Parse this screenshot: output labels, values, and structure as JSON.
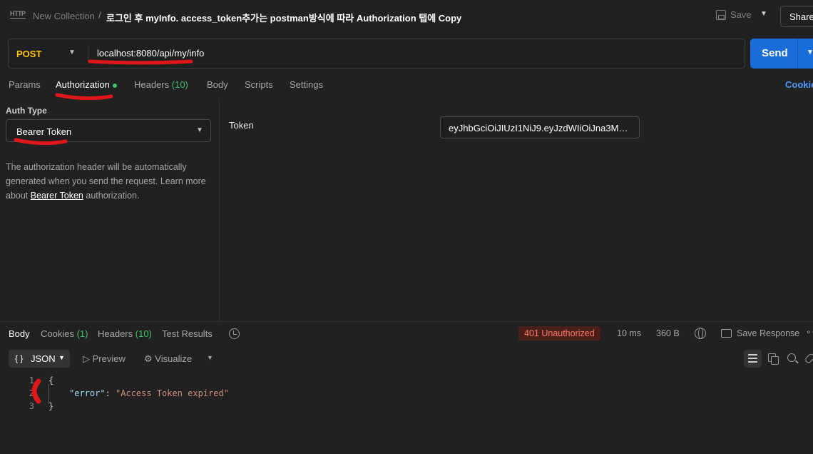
{
  "header": {
    "http_badge": "HTTP",
    "collection": "New Collection",
    "separator": "/",
    "request_name": "로그인 후 myInfo. access_token추가는 postman방식에 따라 Authorization 탭에 Copy",
    "save_label": "Save",
    "share_label": "Share"
  },
  "request": {
    "method": "POST",
    "url": "localhost:8080/api/my/info",
    "send_label": "Send"
  },
  "request_tabs": [
    {
      "label": "Params",
      "count": ""
    },
    {
      "label": "Authorization",
      "count": ""
    },
    {
      "label": "Headers",
      "count": "(10)"
    },
    {
      "label": "Body",
      "count": ""
    },
    {
      "label": "Scripts",
      "count": ""
    },
    {
      "label": "Settings",
      "count": ""
    }
  ],
  "cookies_link": "Cookie",
  "auth": {
    "type_label": "Auth Type",
    "type_value": "Bearer Token",
    "help_prefix": "The authorization header will be automatically generated when you send the request. Learn more about ",
    "help_link": "Bearer Token",
    "help_suffix": " authorization.",
    "token_label": "Token",
    "token_value": "eyJhbGciOiJIUzI1NiJ9.eyJzdWIiOiJna3M5M..."
  },
  "response": {
    "tabs": [
      {
        "label": "Body",
        "count": ""
      },
      {
        "label": "Cookies",
        "count": "(1)"
      },
      {
        "label": "Headers",
        "count": "(10)"
      },
      {
        "label": "Test Results",
        "count": ""
      }
    ],
    "status": "401 Unauthorized",
    "time": "10 ms",
    "size": "360 B",
    "save_response": "Save Response",
    "more": "∘∘",
    "format": "JSON",
    "format_braces": "{ }",
    "preview": "Preview",
    "visualize": "Visualize",
    "line_numbers": [
      "1",
      "2",
      "3"
    ],
    "code": {
      "open": "{",
      "key": "\"error\"",
      "colon": ": ",
      "value": "\"Access Token expired\"",
      "close": "}"
    }
  },
  "colors": {
    "accent_send": "#1a6dd9",
    "method_post": "#ffc400",
    "status_error": "#ff7a66",
    "count_green": "#3ec26b",
    "annotation_red": "#e0161a"
  }
}
